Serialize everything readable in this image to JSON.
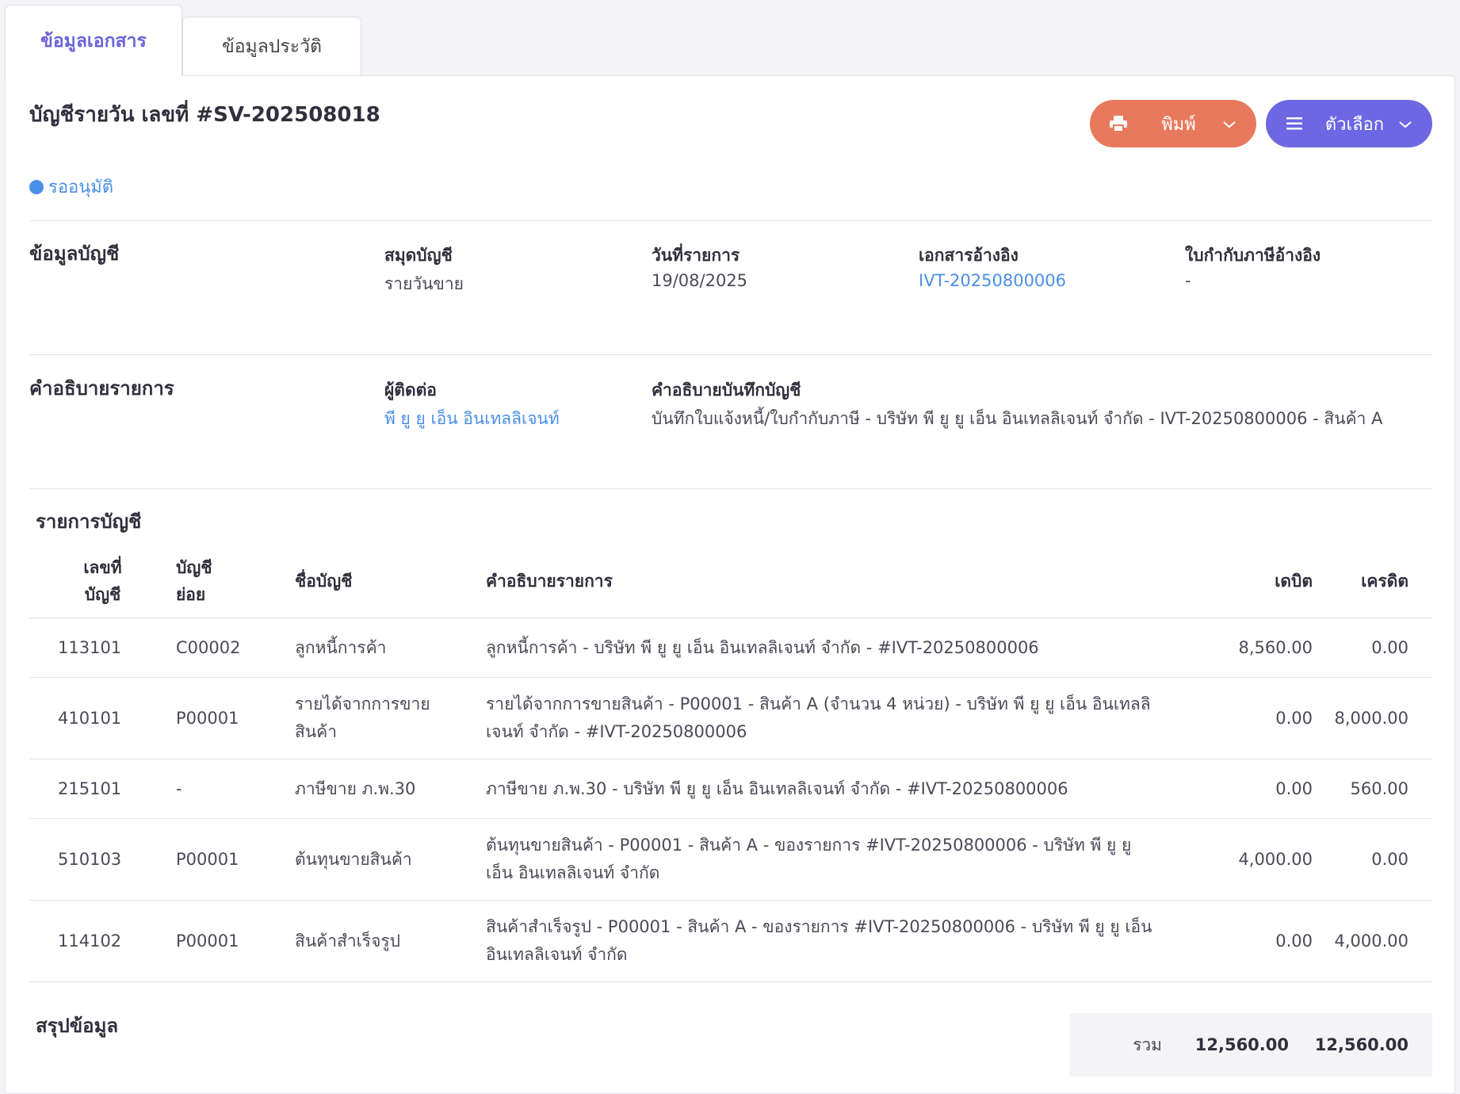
{
  "tabs": {
    "document": "ข้อมูลเอกสาร",
    "history": "ข้อมูลประวัติ"
  },
  "header": {
    "title": "บัญชีรายวัน เลขที่ #SV-202508018",
    "status": "รออนุมัติ",
    "print_label": "พิมพ์",
    "options_label": "ตัวเลือก"
  },
  "account_info": {
    "section_title": "ข้อมูลบัญชี",
    "journal_label": "สมุดบัญชี",
    "journal_value": "รายวันขาย",
    "date_label": "วันที่รายการ",
    "date_value": "19/08/2025",
    "ref_doc_label": "เอกสารอ้างอิง",
    "ref_doc_value": "IVT-20250800006",
    "tax_invoice_label": "ใบกำกับภาษีอ้างอิง",
    "tax_invoice_value": "-"
  },
  "description": {
    "section_title": "คำอธิบายรายการ",
    "contact_label": "ผู้ติดต่อ",
    "contact_value": "พี ยู ยู เอ็น อินเทลลิเจนท์",
    "memo_label": "คำอธิบายบันทึกบัญชี",
    "memo_value": "บันทึกใบแจ้งหนี้/ใบกำกับภาษี - บริษัท พี ยู ยู เอ็น อินเทลลิเจนท์ จำกัด - IVT-20250800006 - สินค้า A"
  },
  "ledger": {
    "section_title": "รายการบัญชี",
    "headers": {
      "account_no_1": "เลขที่",
      "account_no_2": "บัญชี",
      "sub_account_1": "บัญชี",
      "sub_account_2": "ย่อย",
      "account_name": "ชื่อบัญชี",
      "description": "คำอธิบายรายการ",
      "debit": "เดบิต",
      "credit": "เครดิต"
    },
    "rows": [
      {
        "account": "113101",
        "sub": "C00002",
        "name_1": "ลูกหนี้การค้า",
        "name_2": "",
        "desc_1": "ลูกหนี้การค้า - บริษัท พี ยู ยู เอ็น อินเทลลิเจนท์ จำกัด - #IVT-20250800006",
        "desc_2": "",
        "debit": "8,560.00",
        "credit": "0.00"
      },
      {
        "account": "410101",
        "sub": "P00001",
        "name_1": "รายได้จากการขาย",
        "name_2": "สินค้า",
        "desc_1": "รายได้จากการขายสินค้า - P00001 - สินค้า A (จำนวน 4 หน่วย) - บริษัท พี ยู ยู เอ็น อินเทลลิ",
        "desc_2": "เจนท์ จำกัด - #IVT-20250800006",
        "debit": "0.00",
        "credit": "8,000.00"
      },
      {
        "account": "215101",
        "sub": "-",
        "name_1": "ภาษีขาย ภ.พ.30",
        "name_2": "",
        "desc_1": "ภาษีขาย ภ.พ.30 - บริษัท พี ยู ยู เอ็น อินเทลลิเจนท์ จำกัด - #IVT-20250800006",
        "desc_2": "",
        "debit": "0.00",
        "credit": "560.00"
      },
      {
        "account": "510103",
        "sub": "P00001",
        "name_1": "ต้นทุนขายสินค้า",
        "name_2": "",
        "desc_1": "ต้นทุนขายสินค้า - P00001 - สินค้า A - ของรายการ #IVT-20250800006 - บริษัท พี ยู ยู",
        "desc_2": "เอ็น อินเทลลิเจนท์ จำกัด",
        "debit": "4,000.00",
        "credit": "0.00"
      },
      {
        "account": "114102",
        "sub": "P00001",
        "name_1": "สินค้าสำเร็จรูป",
        "name_2": "",
        "desc_1": "สินค้าสำเร็จรูป - P00001 - สินค้า A - ของรายการ #IVT-20250800006 - บริษัท พี ยู ยู เอ็น",
        "desc_2": "อินเทลลิเจนท์ จำกัด",
        "debit": "0.00",
        "credit": "4,000.00"
      }
    ]
  },
  "summary": {
    "section_title": "สรุปข้อมูล",
    "total_label": "รวม",
    "total_debit": "12,560.00",
    "total_credit": "12,560.00"
  }
}
